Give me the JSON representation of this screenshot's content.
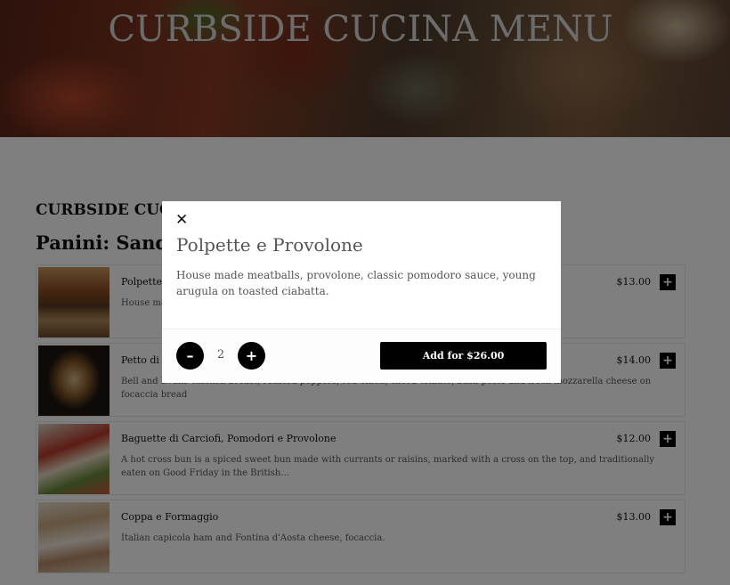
{
  "hero": {
    "title": "CURBSIDE CUCINA MENU"
  },
  "menu": {
    "heading": "CURBSIDE CUCINA MENU",
    "category": "Panini: Sandwiches",
    "items": [
      {
        "name": "Polpette e Provolone",
        "description": "House made meatballs, provolone, classic pomodoro sauce, young arugula on toasted ciabatta.",
        "price": "$13.00",
        "add_icon": "+"
      },
      {
        "name": "Petto di Pollo",
        "description": "Bell and Evans chicken breast, roasted peppers, red onion, sliced tomato, basil pesto and fresh mozzarella cheese on focaccia bread",
        "price": "$14.00",
        "add_icon": "+"
      },
      {
        "name": "Baguette di Carciofi, Pomodori e Provolone",
        "description": "A hot cross bun is a spiced sweet bun made with currants or raisins, marked with a cross on the top, and traditionally eaten on Good Friday in the British...",
        "price": "$12.00",
        "add_icon": "+"
      },
      {
        "name": "Coppa e Formaggio",
        "description": "Italian capicola ham and Fontina d'Aosta cheese, focaccia.",
        "price": "$13.00",
        "add_icon": "+"
      }
    ]
  },
  "modal": {
    "close_icon": "✕",
    "title": "Polpette e Provolone",
    "description": "House made meatballs, provolone, classic pomodoro sauce, young arugula on toasted ciabatta.",
    "quantity": "2",
    "minus_label": "–",
    "plus_label": "+",
    "add_button_label": "Add for $26.00"
  },
  "colors": {
    "overlay": "rgba(0,0,0,0.5)",
    "button": "#000000",
    "text_muted": "#555555"
  }
}
